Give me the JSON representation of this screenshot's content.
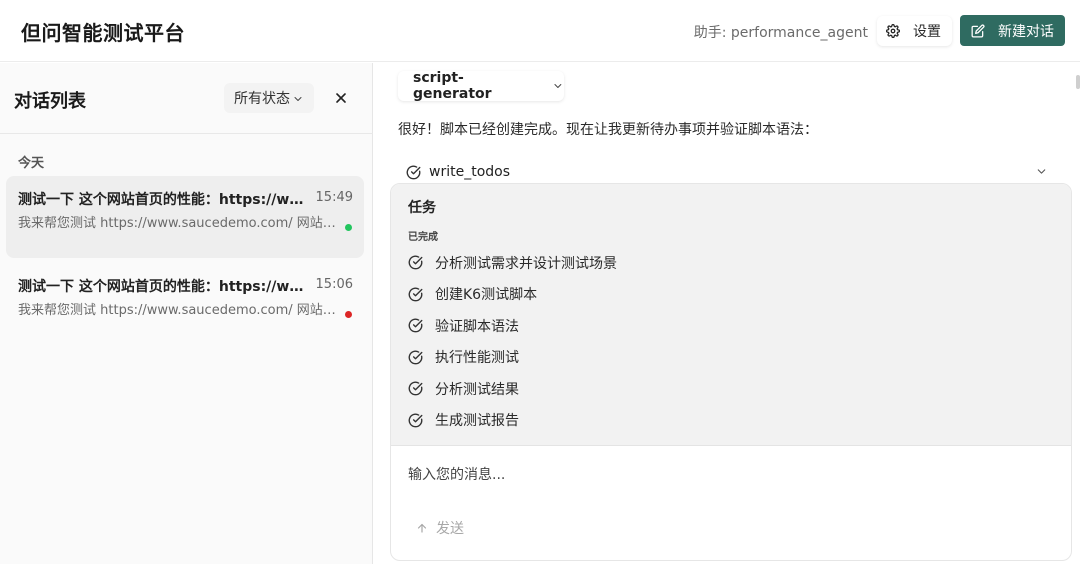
{
  "header": {
    "app_title": "但问智能测试平台",
    "assistant_label": "助手: performance_agent",
    "settings_label": "设置",
    "new_chat_label": "新建对话",
    "accent_color": "#2f6b61"
  },
  "sidebar": {
    "title": "对话列表",
    "status_filter": "所有状态",
    "group_label": "今天",
    "conversations": [
      {
        "title": "测试一下 这个网站首页的性能：https://www.saucedemo.com/",
        "time": "15:49",
        "preview": "我来帮您测试 https://www.saucedemo.com/ 网站首页的性能",
        "status_color": "#22c55e",
        "active": true
      },
      {
        "title": "测试一下 这个网站首页的性能：https://www.saucedemo.com/",
        "time": "15:06",
        "preview": "我来帮您测试 https://www.saucedemo.com/ 网站首页的性能",
        "status_color": "#dc2626",
        "active": false
      }
    ]
  },
  "main": {
    "agent_select": "script-generator",
    "message_text": "很好！脚本已经创建完成。现在让我更新待办事项并验证脚本语法：",
    "tool_name": "write_todos",
    "task_panel": {
      "title": "任务",
      "section_label": "已完成",
      "items": [
        "分析测试需求并设计测试场景",
        "创建K6测试脚本",
        "验证脚本语法",
        "执行性能测试",
        "分析测试结果",
        "生成测试报告"
      ]
    },
    "composer": {
      "placeholder": "输入您的消息...",
      "send_label": "发送"
    }
  }
}
